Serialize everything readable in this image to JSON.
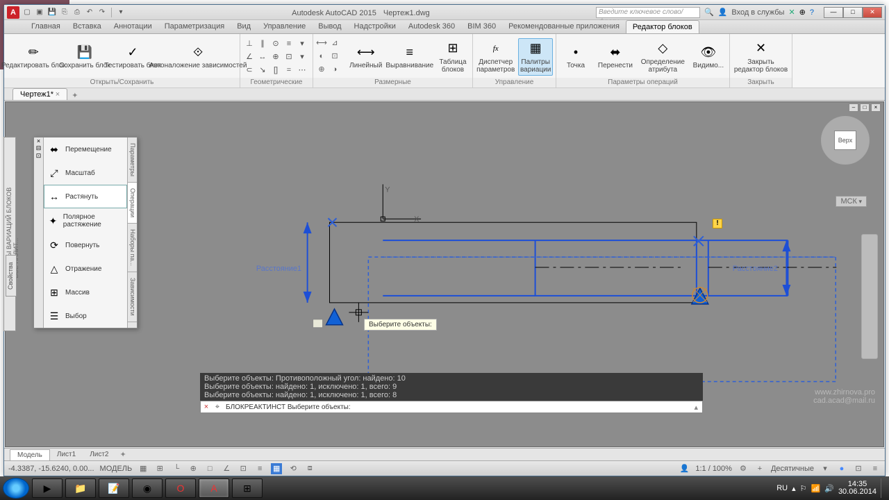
{
  "app": {
    "name": "Autodesk AutoCAD 2015",
    "file": "Чертеж1.dwg"
  },
  "search_placeholder": "Введите ключевое слово/фразу",
  "signin": "Вход в службы",
  "ribbon_tabs": [
    "Главная",
    "Вставка",
    "Аннотации",
    "Параметризация",
    "Вид",
    "Управление",
    "Вывод",
    "Надстройки",
    "Autodesk 360",
    "BIM 360",
    "Рекомендованные приложения",
    "Редактор блоков"
  ],
  "active_tab": 11,
  "panels": {
    "open_save": {
      "title": "Открыть/Сохранить",
      "btns": [
        {
          "l": "Редактировать блок"
        },
        {
          "l": "Сохранить блок"
        },
        {
          "l": "Тестировать блок"
        },
        {
          "l": "Автоналожение зависимостей"
        }
      ]
    },
    "geom": {
      "title": "Геометрические"
    },
    "dim": {
      "title": "Размерные",
      "btns": [
        {
          "l": "Линейный"
        },
        {
          "l": "Выравнивание"
        },
        {
          "l": "Таблица\nблоков"
        }
      ]
    },
    "manage": {
      "title": "Управление",
      "btns": [
        {
          "l": "Диспетчер\nпараметров",
          "i": "fx"
        },
        {
          "l": "Палитры\nвариации",
          "active": true
        }
      ]
    },
    "action": {
      "title": "Параметры операций",
      "btns": [
        {
          "l": "Точка"
        },
        {
          "l": "Перенести"
        },
        {
          "l": "Определение\nатрибута"
        },
        {
          "l": "Видимо..."
        }
      ]
    },
    "close": {
      "title": "Закрыть",
      "btns": [
        {
          "l": "Закрыть\nредактор блоков"
        }
      ]
    }
  },
  "doc_tab": "Чертеж1*",
  "palette": {
    "title": "ПАЛИТРЫ ВАРИАЦИЙ БЛОКОВ - ВСЕ ПАЛИТ...",
    "side_tabs": [
      "Параметры",
      "Операции",
      "Наборы па...",
      "Зависимости"
    ],
    "items": [
      {
        "i": "⬌",
        "t": "Перемещение"
      },
      {
        "i": "⤢",
        "t": "Масштаб"
      },
      {
        "i": "↔",
        "t": "Растянуть",
        "sel": true
      },
      {
        "i": "✦",
        "t": "Полярное растяжение"
      },
      {
        "i": "⟳",
        "t": "Повернуть"
      },
      {
        "i": "△",
        "t": "Отражение"
      },
      {
        "i": "⊞",
        "t": "Массив"
      },
      {
        "i": "☰",
        "t": "Выбор"
      }
    ]
  },
  "labels": {
    "d1": "Расстояние1",
    "d2": "Расстояние2",
    "y": "Y",
    "x": "X"
  },
  "tooltip": "Выберите объекты:",
  "viewcube": "Верх",
  "mcs": "МСК",
  "cmd_hist": [
    "Выберите объекты: Противоположный угол: найдено: 10",
    "Выберите объекты: найдено: 1, исключено: 1, всего: 9",
    "Выберите объекты: найдено: 1, исключено: 1, всего: 8"
  ],
  "cmd_line": "БЛОКРЕАКТИНСТ Выберите объекты:",
  "model_tabs": [
    "Модель",
    "Лист1",
    "Лист2"
  ],
  "status": {
    "coords": "-4.3387, -15.6240, 0.00...",
    "space": "МОДЕЛЬ",
    "zoom": "1:1 / 100%",
    "units": "Десятичные"
  },
  "watermark": {
    "l1": "www.zhirnova.pro",
    "l2": "cad.acad@mail.ru"
  },
  "tray": {
    "lang": "RU",
    "time": "14:35",
    "date": "30.06.2014"
  },
  "props_label": "Свойства"
}
